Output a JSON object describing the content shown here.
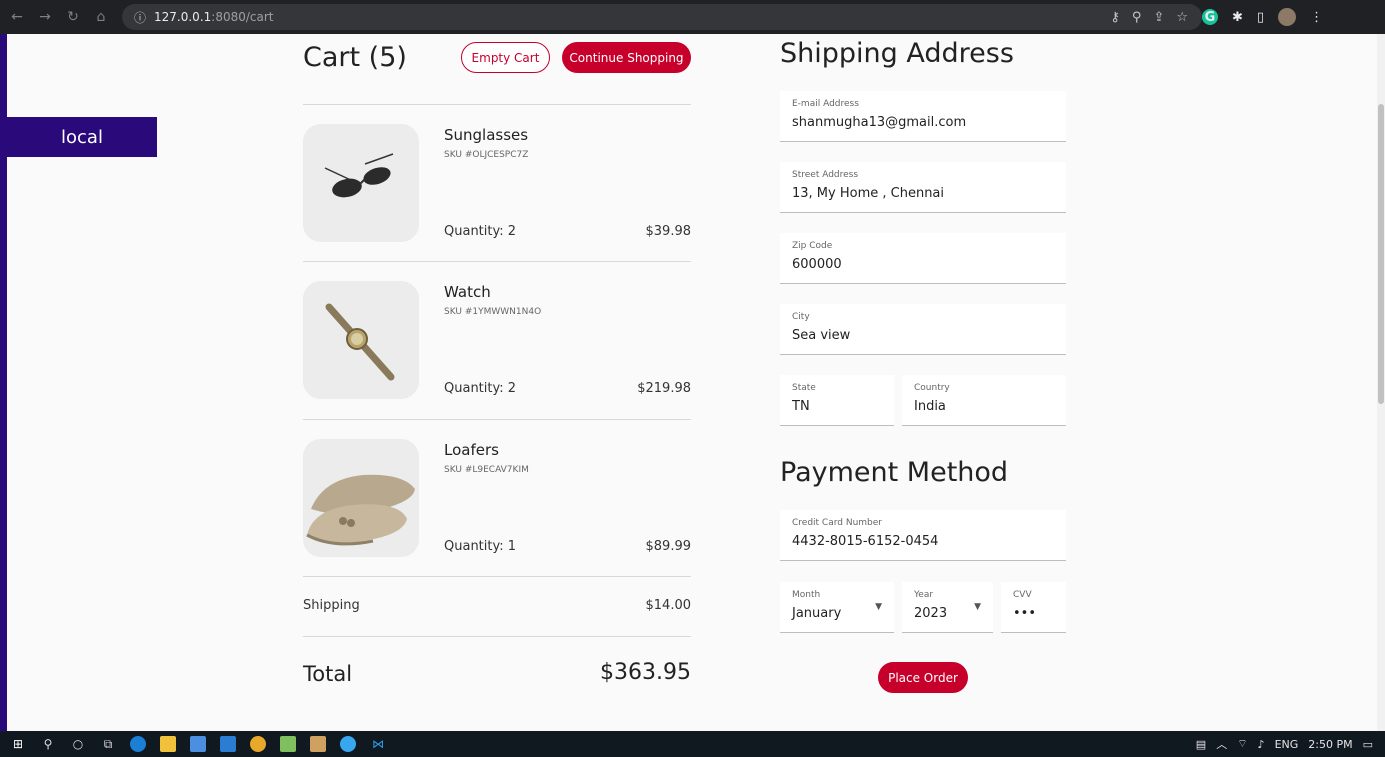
{
  "browser": {
    "url_host": "127.0.0.1",
    "url_path": ":8080/cart"
  },
  "env_badge": "local",
  "cart": {
    "title": "Cart (5)",
    "empty_label": "Empty Cart",
    "continue_label": "Continue Shopping",
    "items": [
      {
        "name": "Sunglasses",
        "sku": "SKU #OLJCESPC7Z",
        "qty": "Quantity: 2",
        "price": "$39.98"
      },
      {
        "name": "Watch",
        "sku": "SKU #1YMWWN1N4O",
        "qty": "Quantity: 2",
        "price": "$219.98"
      },
      {
        "name": "Loafers",
        "sku": "SKU #L9ECAV7KIM",
        "qty": "Quantity: 1",
        "price": "$89.99"
      }
    ],
    "shipping_label": "Shipping",
    "shipping_value": "$14.00",
    "total_label": "Total",
    "total_value": "$363.95"
  },
  "shipping": {
    "title": "Shipping Address",
    "email_label": "E-mail Address",
    "email_value": "shanmugha13@gmail.com",
    "street_label": "Street Address",
    "street_value": "13, My Home , Chennai",
    "zip_label": "Zip Code",
    "zip_value": "600000",
    "city_label": "City",
    "city_value": "Sea view",
    "state_label": "State",
    "state_value": "TN",
    "country_label": "Country",
    "country_value": "India"
  },
  "payment": {
    "title": "Payment Method",
    "card_label": "Credit Card Number",
    "card_value": "4432-8015-6152-0454",
    "month_label": "Month",
    "month_value": "January",
    "year_label": "Year",
    "year_value": "2023",
    "cvv_label": "CVV",
    "cvv_value": "•••",
    "order_label": "Place Order"
  },
  "taskbar": {
    "lang": "ENG",
    "time": "2:50 PM"
  },
  "colors": {
    "accent": "#c7002b",
    "badge": "#2a0a7a"
  }
}
